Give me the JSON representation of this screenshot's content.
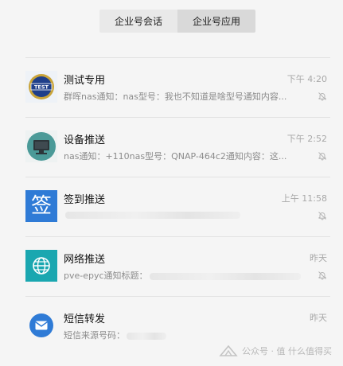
{
  "tabs": [
    {
      "label": "企业号会话",
      "active": false
    },
    {
      "label": "企业号应用",
      "active": true
    }
  ],
  "conversations": [
    {
      "title": "测试专用",
      "time": "下午 4:20",
      "preview": "群晖nas通知：nas型号：我也不知道是啥型号通知内容...",
      "avatar_icon": "test-badge-icon",
      "muted": true
    },
    {
      "title": "设备推送",
      "time": "下午 2:52",
      "preview": "nas通知：+110nas型号：QNAP-464c2通知内容：这...",
      "avatar_icon": "computer-icon",
      "muted": true
    },
    {
      "title": "签到推送",
      "time": "上午 11:58",
      "preview": "",
      "avatar_icon": "sign-in-icon",
      "muted": true
    },
    {
      "title": "网络推送",
      "time": "昨天",
      "preview": "pve-epyc通知标题：",
      "avatar_icon": "globe-icon",
      "muted": true
    },
    {
      "title": "短信转发",
      "time": "昨天",
      "preview": "短信来源号码：",
      "avatar_icon": "message-icon",
      "muted": false
    }
  ],
  "avatar_glyphs": {
    "sign_in": "签",
    "test": "TEST"
  },
  "watermark": {
    "text": "公众号 · 值 什么值得买"
  },
  "colors": {
    "blue": "#2f7bd6",
    "teal": "#1aa7b0",
    "grey_teal": "#4b9a98",
    "page_bg": "#f5f5f5"
  }
}
